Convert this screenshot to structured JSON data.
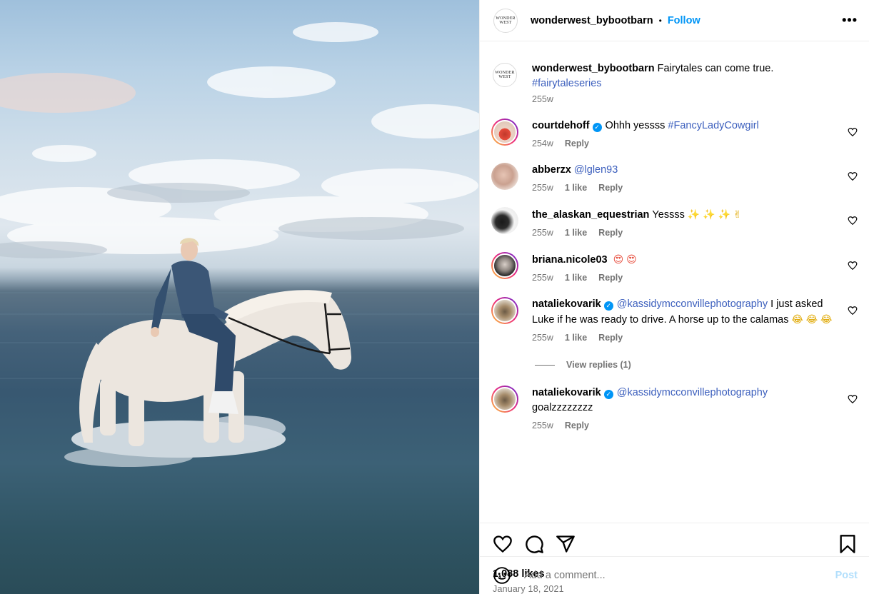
{
  "header": {
    "username": "wonderwest_bybootbarn",
    "separator": "•",
    "follow_label": "Follow",
    "more_label": "•••",
    "logo_text_line1": "WONDER",
    "logo_text_line2": "WEST"
  },
  "caption": {
    "username": "wonderwest_bybootbarn",
    "text": "Fairytales can come true.",
    "hashtag": "#fairytaleseries",
    "time": "255w"
  },
  "comments": [
    {
      "username": "courtdehoff",
      "verified": true,
      "text": "Ohhh yessss",
      "tag": "#FancyLadyCowgirl",
      "time": "254w",
      "likes": "",
      "reply": "Reply"
    },
    {
      "username": "abberzx",
      "verified": false,
      "text": "",
      "tag": "@lglen93",
      "time": "255w",
      "likes": "1 like",
      "reply": "Reply"
    },
    {
      "username": "the_alaskan_equestrian",
      "verified": false,
      "text": "Yessss",
      "emojis": "✨ ✨ ✨ ✌",
      "time": "255w",
      "likes": "1 like",
      "reply": "Reply"
    },
    {
      "username": "briana.nicole03",
      "verified": false,
      "emojis": "😍 😍",
      "time": "255w",
      "likes": "1 like",
      "reply": "Reply"
    },
    {
      "username": "nataliekovarik",
      "verified": true,
      "tag": "@kassidymcconvillephotography",
      "text": "I just asked Luke if he was ready to drive. A horse up to the calamas",
      "emojis": "😂 😂 😂",
      "time": "255w",
      "likes": "1 like",
      "reply": "Reply",
      "view_replies": "View replies (1)"
    },
    {
      "username": "nataliekovarik",
      "verified": true,
      "tag": "@kassidymcconvillephotography",
      "text": "goalzzzzzzzz",
      "time": "255w",
      "likes": "",
      "reply": "Reply"
    }
  ],
  "stats": {
    "likes": "1,088 likes",
    "date": "January 18, 2021"
  },
  "composer": {
    "placeholder": "Add a comment...",
    "post_label": "Post"
  },
  "colors": {
    "link": "#3c5fbd",
    "follow": "#0095f6",
    "muted": "#737373"
  }
}
